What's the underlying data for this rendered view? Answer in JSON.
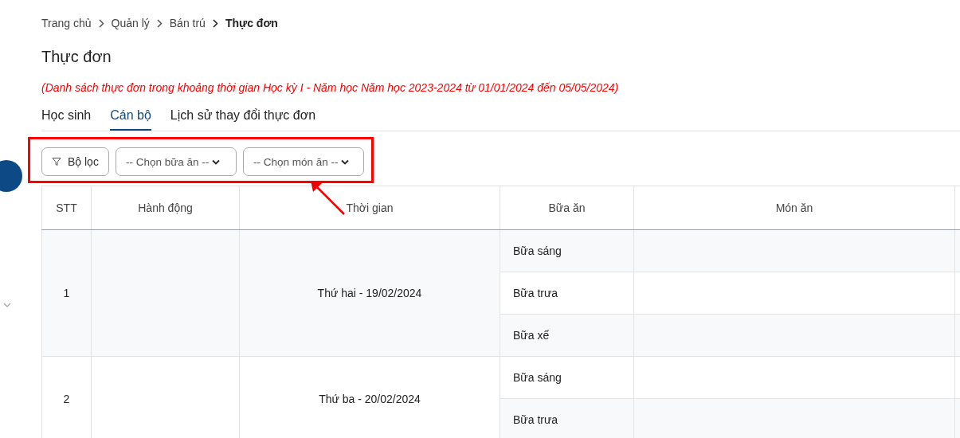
{
  "breadcrumb": [
    {
      "label": "Trang chủ",
      "current": false
    },
    {
      "label": "Quản lý",
      "current": false
    },
    {
      "label": "Bán trú",
      "current": false
    },
    {
      "label": "Thực đơn",
      "current": true
    }
  ],
  "page_title": "Thực đơn",
  "notice": "(Danh sách thực đơn trong khoảng thời gian Học kỳ I - Năm học Năm học 2023-2024 từ 01/01/2024 đến 05/05/2024)",
  "tabs": [
    {
      "label": "Học sinh",
      "selected": false
    },
    {
      "label": "Cán bộ",
      "selected": true
    },
    {
      "label": "Lịch sử thay đổi thực đơn",
      "selected": false
    }
  ],
  "filters": {
    "filter_button": "Bộ lọc",
    "meal_select": "-- Chọn bữa ăn --",
    "dish_select": "-- Chọn món ăn --"
  },
  "table": {
    "columns": [
      "STT",
      "Hành động",
      "Thời gian",
      "Bữa ăn",
      "Món ăn"
    ],
    "rows": [
      {
        "stt": "1",
        "time": "Thứ hai - 19/02/2024",
        "meals": [
          "Bữa sáng",
          "Bữa trưa",
          "Bữa xế"
        ]
      },
      {
        "stt": "2",
        "time": "Thứ ba - 20/02/2024",
        "meals": [
          "Bữa sáng",
          "Bữa trưa"
        ]
      }
    ]
  }
}
